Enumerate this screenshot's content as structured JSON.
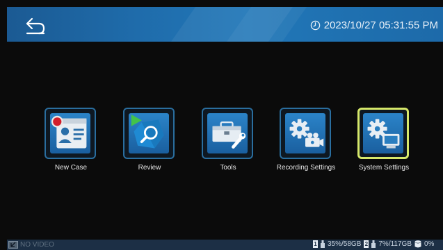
{
  "header": {
    "back_icon": "back-arrow-icon",
    "clock_icon": "clock-icon",
    "datetime": "2023/10/27 05:31:55 PM"
  },
  "menu": {
    "items": [
      {
        "label": "New Case",
        "icon": "new-case-id-card-icon",
        "selected": false
      },
      {
        "label": "Review",
        "icon": "review-magnifier-play-icon",
        "selected": false
      },
      {
        "label": "Tools",
        "icon": "toolbox-wrench-icon",
        "selected": false
      },
      {
        "label": "Recording Settings",
        "icon": "gear-camera-icon",
        "selected": false
      },
      {
        "label": "System Settings",
        "icon": "gear-monitor-icon",
        "selected": true
      }
    ]
  },
  "footer": {
    "video_status": "NO VIDEO",
    "drive1_index": "1",
    "drive1_usage": "35%/58GB",
    "drive2_index": "2",
    "drive2_usage": "7%/117GB",
    "db_icon": "database-icon",
    "db_usage": "0%"
  },
  "colors": {
    "header_blue": "#1f6cab",
    "tile_border": "#2a6e9f",
    "selected_border": "#d6e86a",
    "footer_bg": "#1c2f45"
  }
}
